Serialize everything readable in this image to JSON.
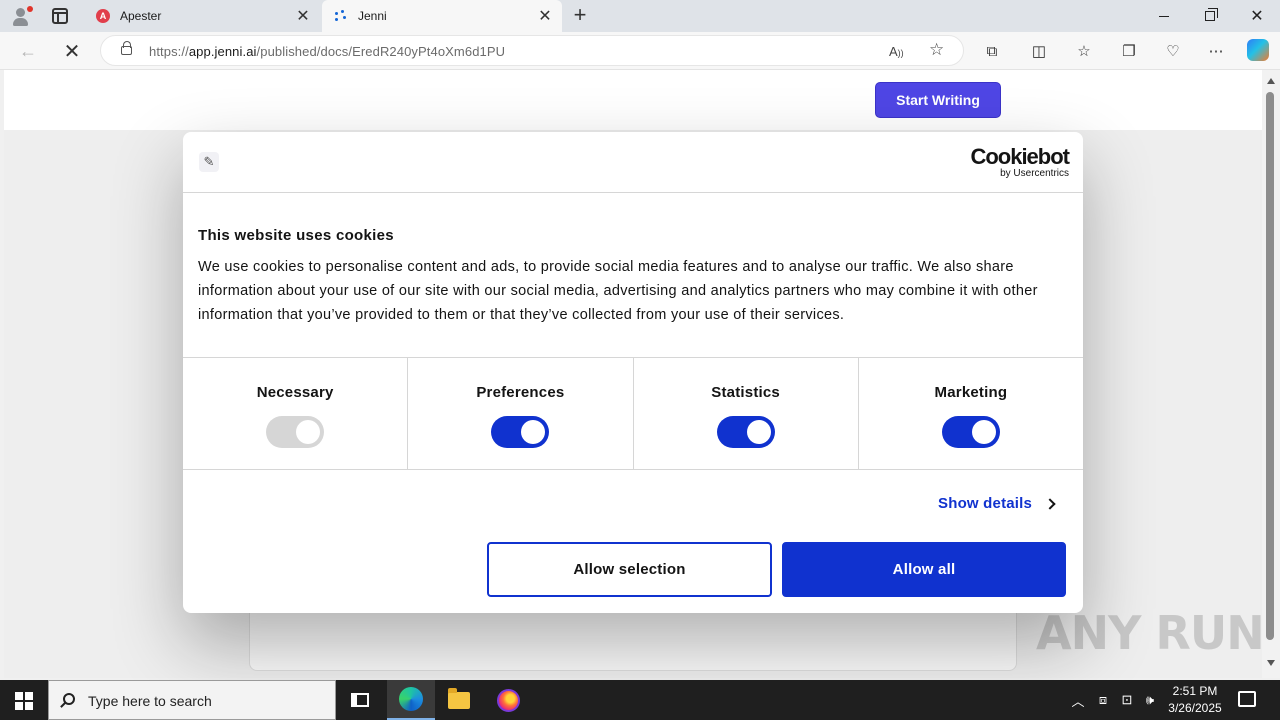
{
  "browser": {
    "tabs": [
      {
        "title": "Apester",
        "favicon": "A"
      },
      {
        "title": "Jenni"
      }
    ],
    "url_scheme": "https://",
    "url_host": "app.jenni.ai",
    "url_path": "/published/docs/EredR240yPt4oXm6d1PU"
  },
  "page": {
    "start_writing_label": "Start Writing"
  },
  "cookie_dialog": {
    "brand_name": "Cookiebot",
    "brand_sub": "by Usercentrics",
    "title": "This website uses cookies",
    "body": "We use cookies to personalise content and ads, to provide social media features and to analyse our traffic. We also share information about your use of our site with our social media, advertising and analytics partners who may combine it with other information that you’ve provided to them or that they’ve collected from your use of their services.",
    "categories": [
      {
        "label": "Necessary",
        "enabled": true,
        "locked": true
      },
      {
        "label": "Preferences",
        "enabled": true
      },
      {
        "label": "Statistics",
        "enabled": true
      },
      {
        "label": "Marketing",
        "enabled": true
      }
    ],
    "show_details_label": "Show details",
    "allow_selection_label": "Allow selection",
    "allow_all_label": "Allow all",
    "accent_color": "#1032cf"
  },
  "watermark": "ANY RUN",
  "taskbar": {
    "search_placeholder": "Type here to search",
    "time": "2:51 PM",
    "date": "3/26/2025"
  }
}
